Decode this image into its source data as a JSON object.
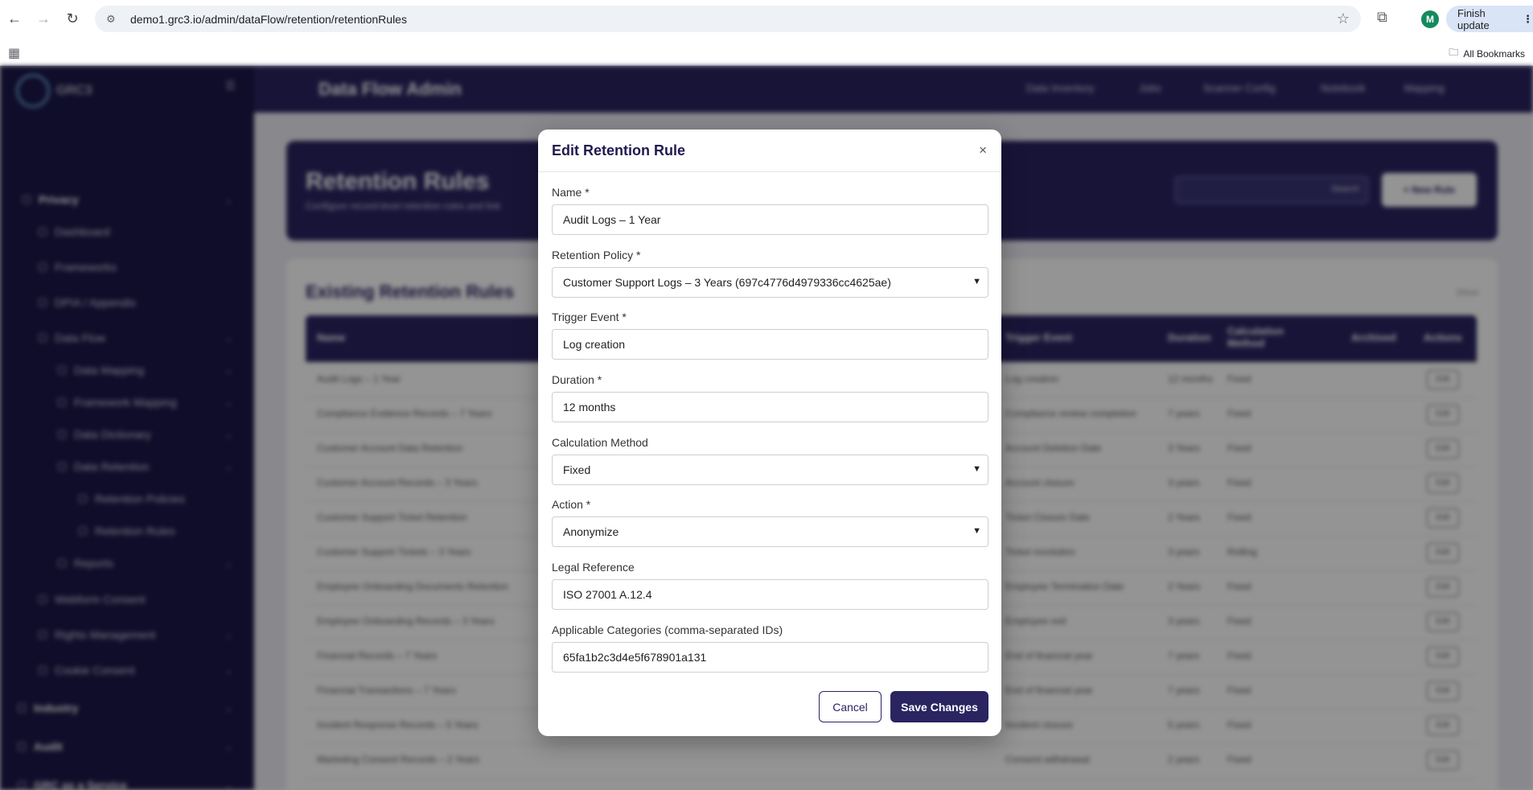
{
  "browser": {
    "url": "demo1.grc3.io/admin/dataFlow/retention/retentionRules",
    "profile_initial": "M",
    "update_label": "Finish update",
    "bookmarks_label": "All Bookmarks"
  },
  "app": {
    "brand": "GRC3",
    "header_title": "Data Flow Admin",
    "top_nav": [
      "Data Inventory",
      "Jobs",
      "Scanner Config",
      "Notebook",
      "Mapping"
    ],
    "sidebar": [
      {
        "label": "Privacy"
      },
      {
        "label": "Dashboard"
      },
      {
        "label": "Frameworks"
      },
      {
        "label": "DPIA / Appendix"
      },
      {
        "label": "Data Flow"
      },
      {
        "label": "Data Mapping"
      },
      {
        "label": "Framework Mapping"
      },
      {
        "label": "Data Dictionary"
      },
      {
        "label": "Data Retention"
      },
      {
        "label": "Retention Policies"
      },
      {
        "label": "Retention Rules"
      },
      {
        "label": "Reports"
      },
      {
        "label": "Webform Consent"
      },
      {
        "label": "Rights Management"
      },
      {
        "label": "Cookie Consent"
      },
      {
        "label": "Industry"
      },
      {
        "label": "Audit"
      },
      {
        "label": "GRC as a Service"
      }
    ],
    "page_title": "Retention Rules",
    "page_subtitle": "Configure record-level retention rules and link",
    "search_button": "Search",
    "new_button": "+ New Rule",
    "section_title": "Existing Retention Rules",
    "section_meta": "Show",
    "table_headers": [
      "Name",
      "Trigger Event",
      "Duration",
      "Calculation Method",
      "Archived",
      "Actions"
    ],
    "rows": [
      {
        "name": "Audit Logs – 1 Year",
        "trigger": "Log creation",
        "duration": "12 months",
        "method": "Fixed"
      },
      {
        "name": "Compliance Evidence Records – 7 Years",
        "trigger": "Compliance review completion",
        "duration": "7 years",
        "method": "Fixed"
      },
      {
        "name": "Customer Account Data Retention",
        "trigger": "Account Deletion Date",
        "duration": "3 Years",
        "method": "Fixed"
      },
      {
        "name": "Customer Account Records – 3 Years",
        "trigger": "Account closure",
        "duration": "3 years",
        "method": "Fixed"
      },
      {
        "name": "Customer Support Ticket Retention",
        "trigger": "Ticket Closure Date",
        "duration": "2 Years",
        "method": "Fixed"
      },
      {
        "name": "Customer Support Tickets – 3 Years",
        "trigger": "Ticket resolution",
        "duration": "3 years",
        "method": "Rolling"
      },
      {
        "name": "Employee Onboarding Documents Retention",
        "trigger": "Employee Termination Date",
        "duration": "2 Years",
        "method": "Fixed"
      },
      {
        "name": "Employee Onboarding Records – 3 Years",
        "trigger": "Employee exit",
        "duration": "3 years",
        "method": "Fixed"
      },
      {
        "name": "Financial Records – 7 Years",
        "trigger": "End of financial year",
        "duration": "7 years",
        "method": "Fixed"
      },
      {
        "name": "Financial Transactions – 7 Years",
        "trigger": "End of financial year",
        "duration": "7 years",
        "method": "Fixed"
      },
      {
        "name": "Incident Response Records – 5 Years",
        "trigger": "Incident closure",
        "duration": "5 years",
        "method": "Fixed"
      },
      {
        "name": "Marketing Consent Records – 2 Years",
        "trigger": "Consent withdrawal",
        "duration": "2 years",
        "method": "Fixed"
      }
    ],
    "row_edit_label": "Edit"
  },
  "modal": {
    "title": "Edit Retention Rule",
    "close_glyph": "×",
    "name_label": "Name *",
    "name_value": "Audit Logs – 1 Year",
    "policy_label": "Retention Policy *",
    "policy_value": "Customer Support Logs – 3 Years (697c4776d4979336cc4625ae)",
    "trigger_label": "Trigger Event *",
    "trigger_value": "Log creation",
    "duration_label": "Duration *",
    "duration_value": "12 months",
    "method_label": "Calculation Method",
    "method_value": "Fixed",
    "action_label": "Action *",
    "action_value": "Anonymize",
    "legal_label": "Legal Reference",
    "legal_value": "ISO 27001 A.12.4",
    "categories_label": "Applicable Categories (comma-separated IDs)",
    "categories_value": "65fa1b2c3d4e5f678901a131",
    "cancel_label": "Cancel",
    "save_label": "Save Changes"
  }
}
